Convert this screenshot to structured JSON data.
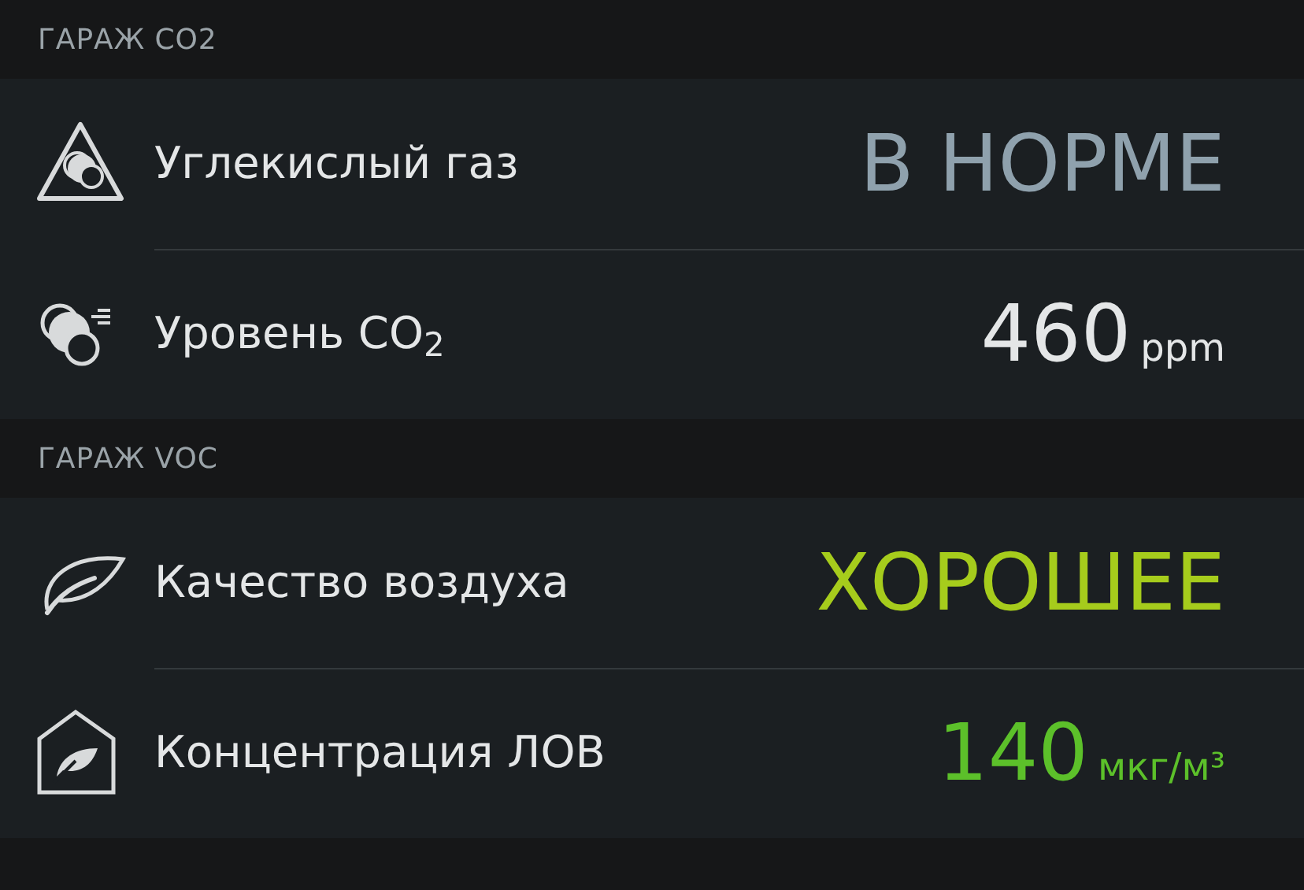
{
  "sections": [
    {
      "title": "ГАРАЖ CO2",
      "rows": [
        {
          "label": "Углекислый газ",
          "kind": "status",
          "value": "В НОРМЕ",
          "color": "#8fa1ad"
        },
        {
          "label": "Уровень CO$_{2}$",
          "kind": "reading",
          "value": "460",
          "unit": "ppm",
          "color": "#e4e6e7"
        }
      ]
    },
    {
      "title": "ГАРАЖ VOC",
      "rows": [
        {
          "label": "Качество воздуха",
          "kind": "status",
          "value": "ХОРОШЕЕ",
          "color": "#a6cc1c"
        },
        {
          "label": "Концентрация ЛОВ",
          "kind": "reading",
          "value": "140",
          "unit": "мкг/м³",
          "color": "#5cc02a"
        }
      ]
    }
  ]
}
